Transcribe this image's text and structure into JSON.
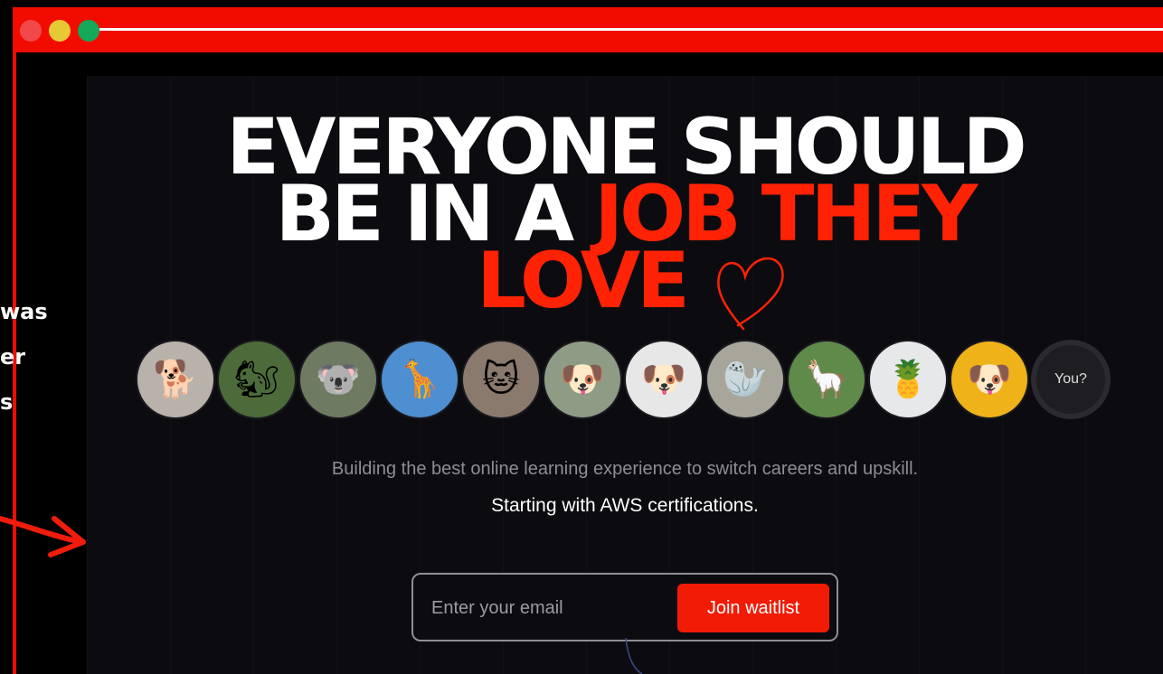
{
  "window": {
    "traffic_lights": [
      "close",
      "minimize",
      "maximize"
    ]
  },
  "side_note": {
    "lines": [
      "was",
      "er",
      "s"
    ]
  },
  "hero": {
    "headline_white_1": "EVERYONE SHOULD",
    "headline_white_2": "BE IN A ",
    "headline_red_1": "JOB THEY",
    "headline_red_2": "LOVE"
  },
  "avatars": {
    "items": [
      {
        "name": "fluffy-dog-avatar",
        "glyph": "🐕",
        "bg": "#b9b2aa"
      },
      {
        "name": "squirrel-avatar",
        "glyph": "🐿",
        "bg": "#4d6b3a"
      },
      {
        "name": "koala-avatar",
        "glyph": "🐨",
        "bg": "#6f7a62"
      },
      {
        "name": "giraffe-avatar",
        "glyph": "🦒",
        "bg": "#4e8fd1"
      },
      {
        "name": "kitten-avatar",
        "glyph": "🐱",
        "bg": "#8a7a6e"
      },
      {
        "name": "pug-blanket-avatar",
        "glyph": "🐶",
        "bg": "#8e9c86"
      },
      {
        "name": "pug-glasses-avatar",
        "glyph": "🐶",
        "bg": "#e7e7e7"
      },
      {
        "name": "seal-avatar",
        "glyph": "🦭",
        "bg": "#a8a69a"
      },
      {
        "name": "alpaca-avatar",
        "glyph": "🦙",
        "bg": "#5f8a4a"
      },
      {
        "name": "pineapple-avatar",
        "glyph": "🍍",
        "bg": "#e6e8ea"
      },
      {
        "name": "pug-yellow-avatar",
        "glyph": "🐶",
        "bg": "#f0b219"
      }
    ],
    "you_label": "You?"
  },
  "tagline": {
    "line1": "Building the best online learning experience to switch careers and upskill.",
    "line2": "Starting with AWS certifications."
  },
  "waitlist": {
    "email_placeholder": "Enter your email",
    "button_label": "Join waitlist"
  },
  "colors": {
    "frame": "#f20c00",
    "accent": "#ff2205",
    "button": "#f21b06",
    "background": "#0c0c10"
  }
}
